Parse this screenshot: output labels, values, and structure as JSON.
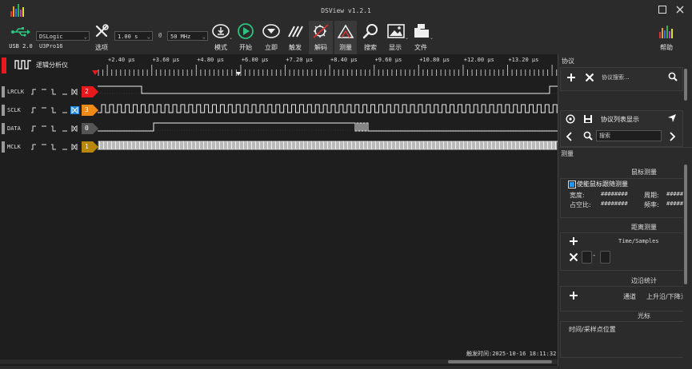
{
  "window": {
    "title": "DSView v1.2.1"
  },
  "toolbar": {
    "device_mode": "USB 2.0",
    "device": "DSLogic U3Pro16",
    "options_label": "选项",
    "time_value": "1.00 s",
    "at": "@",
    "rate_value": "50 MHz",
    "mode_label": "模式",
    "start_label": "开始",
    "instant_label": "立即",
    "trigger_label": "触发",
    "decode_label": "解码",
    "measure_label": "测量",
    "search_label": "搜索",
    "display_label": "显示",
    "file_label": "文件",
    "help_label": "帮助"
  },
  "wave": {
    "panel_label": "逻辑分析仪",
    "ticks": [
      "+2.40 μs",
      "+3.60 μs",
      "+4.80 μs",
      "+6.00 μs",
      "+7.20 μs",
      "+8.40 μs",
      "+9.60 μs",
      "+10.80 μs",
      "+12.00 μs",
      "+13.20 μs"
    ],
    "channels": [
      {
        "name": "LRCLK",
        "index": "2",
        "color": "#e8191d"
      },
      {
        "name": "SCLK",
        "index": "3",
        "color": "#ef8a17"
      },
      {
        "name": "DATA",
        "index": "0",
        "color": "#555555"
      },
      {
        "name": "MCLK",
        "index": "1",
        "color": "#b8860b"
      }
    ],
    "trigger_time": "触发时间:2025-10-16 18:11:32"
  },
  "protocol": {
    "title": "协议",
    "search_placeholder": "协议搜索...",
    "list_label": "协议列表显示",
    "search2_placeholder": "搜索"
  },
  "measure": {
    "title": "测量",
    "mouse_title": "鼠标测量",
    "enable_label": "使能鼠标跟随测量",
    "width_label": "宽度:",
    "width_value": "########",
    "period_label": "周期:",
    "period_value": "#####",
    "duty_label": "占空比:",
    "duty_value": "########",
    "freq_label": "频率:",
    "freq_value": "#####",
    "distance_title": "距离测量",
    "time_samples": "Time/Samples",
    "dash": "-",
    "edge_title": "边沿统计",
    "channel_label": "通道",
    "edge_label": "上升沿/下降沿",
    "cursor_title": "光标",
    "cursor_label": "时间/采样点位置"
  },
  "colors": {
    "start": "#2ec27e",
    "accent": "#2196f3"
  }
}
